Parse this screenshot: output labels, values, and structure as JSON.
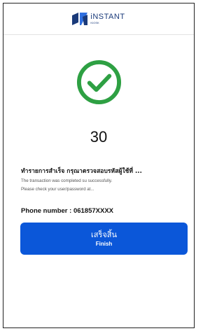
{
  "header": {
    "logo_title": "iNSTANT",
    "logo_sub": "KIOSK"
  },
  "status": {
    "icon": "check-circle-icon",
    "color": "#2ea043",
    "countdown": "30"
  },
  "message": {
    "thai": "ทำรายการสำเร็จ กรุณาตรวจสอบรหัสผู้ใช้ที่ ...",
    "en_line1": "The transaction was completed su successfully.",
    "en_line2": "Please check your user/password at..."
  },
  "phone": {
    "text": "Phone number : 061857XXXX"
  },
  "finish_button": {
    "label_th": "เสร็จสิ้น",
    "label_en": "Finish",
    "color": "#0b57d9"
  }
}
